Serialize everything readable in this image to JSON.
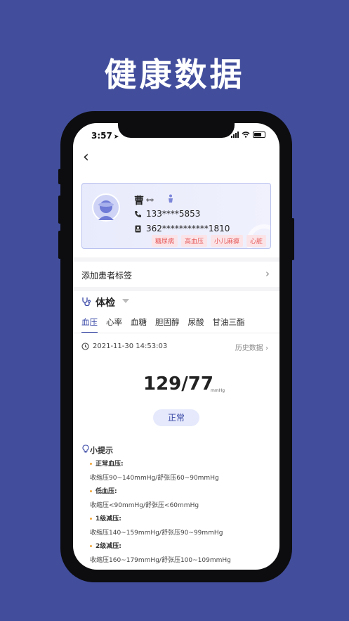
{
  "promo": {
    "title": "健康数据"
  },
  "status_bar": {
    "time": "3:57"
  },
  "patient": {
    "name": "曹",
    "name_mask": "**",
    "phone": "133****5853",
    "id_number": "362***********1810",
    "tags": [
      "糖尿病",
      "高血压",
      "小儿麻痹",
      "心脏"
    ]
  },
  "add_tag": {
    "label": "添加患者标签"
  },
  "section": {
    "title": "体检"
  },
  "tabs": [
    {
      "label": "血压",
      "active": true
    },
    {
      "label": "心率"
    },
    {
      "label": "血糖"
    },
    {
      "label": "胆固醇"
    },
    {
      "label": "尿酸"
    },
    {
      "label": "甘油三酯"
    }
  ],
  "record": {
    "datetime": "2021-11-30 14:53:03",
    "history_label": "历史数据",
    "value": "129/77",
    "unit": "mmHg",
    "status": "正常"
  },
  "tips": {
    "title": "小提示",
    "items": [
      {
        "heading": "正常血压:",
        "desc": "收缩压90~140mmHg/舒张压60~90mmHg"
      },
      {
        "heading": "低血压:",
        "desc": "收缩压<90mmHg/舒张压<60mmHg"
      },
      {
        "heading": "1级减压:",
        "desc": "收缩压140~159mmHg/舒张压90~99mmHg"
      },
      {
        "heading": "2级减压:",
        "desc": "收缩压160~179mmHg/舒张压100~109mmHg"
      }
    ]
  },
  "colors": {
    "background": "#424e9c",
    "accent": "#3a49a6",
    "tag_text": "#e65c5c",
    "tip_dot": "#f0a63a"
  },
  "icons": [
    "back-icon",
    "avatar-icon",
    "gender-icon",
    "phone-icon",
    "id-card-icon",
    "chevron-right-icon",
    "checkup-icon",
    "caret-down-icon",
    "clock-icon",
    "bulb-icon"
  ]
}
